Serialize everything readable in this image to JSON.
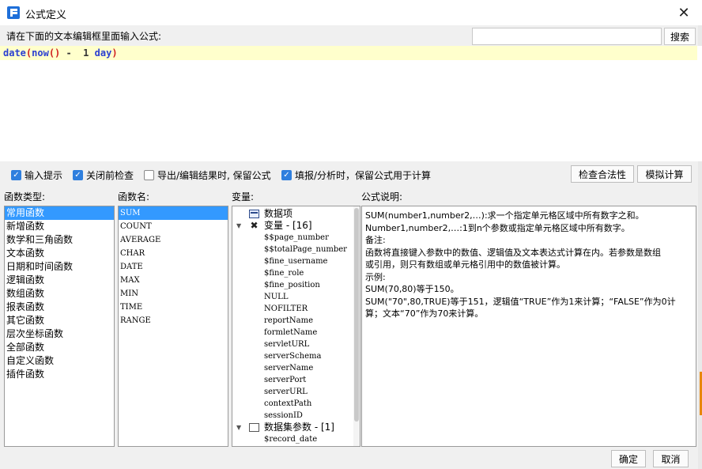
{
  "window": {
    "title": "公式定义",
    "close_label": "✕"
  },
  "prompt": {
    "label": "请在下面的文本编辑框里面输入公式:",
    "search_placeholder": "",
    "search_button": "搜索"
  },
  "editor": {
    "tokens": [
      "date",
      "(",
      "now",
      "()",
      " -  1 ",
      "day",
      ")"
    ]
  },
  "options": [
    {
      "label": "输入提示",
      "checked": true
    },
    {
      "label": "关闭前检查",
      "checked": true
    },
    {
      "label": "导出/编辑结果时, 保留公式",
      "checked": false
    },
    {
      "label": "填报/分析时，保留公式用于计算",
      "checked": true
    }
  ],
  "buttons": {
    "check": "检查合法性",
    "simulate": "模拟计算",
    "ok": "确定",
    "cancel": "取消"
  },
  "headers": {
    "func_type": "函数类型:",
    "func_name": "函数名:",
    "variables": "变量:",
    "description": "公式说明:"
  },
  "func_types": [
    "常用函数",
    "新增函数",
    "数学和三角函数",
    "文本函数",
    "日期和时间函数",
    "逻辑函数",
    "数组函数",
    "报表函数",
    "其它函数",
    "层次坐标函数",
    "全部函数",
    "自定义函数",
    "插件函数"
  ],
  "func_names": [
    "SUM",
    "COUNT",
    "AVERAGE",
    "CHAR",
    "DATE",
    "MAX",
    "MIN",
    "TIME",
    "RANGE"
  ],
  "variables": {
    "data_item": "数据项",
    "var_group": "变量 - [16]",
    "var_items": [
      "$$page_number",
      "$$totalPage_number",
      "$fine_username",
      "$fine_role",
      "$fine_position",
      "NULL",
      "NOFILTER",
      "reportName",
      "formletName",
      "servletURL",
      "serverSchema",
      "serverName",
      "serverPort",
      "serverURL",
      "contextPath",
      "sessionID"
    ],
    "ds_group": "数据集参数 - [1]",
    "ds_items": [
      "$record_date"
    ]
  },
  "description": [
    "SUM(number1,number2,…):求一个指定单元格区域中所有数字之和。",
    "Number1,number2,…:1到n个参数或指定单元格区域中所有数字。",
    "备注:",
    "函数将直接键入参数中的数值、逻辑值及文本表达式计算在内。若参数是数组",
    "或引用，则只有数组或单元格引用中的数值被计算。",
    "示例:",
    "SUM(70,80)等于150。",
    "SUM(\"70\",80,TRUE)等于151，逻辑值“TRUE”作为1来计算；“FALSE”作为0计",
    "算；文本“70”作为70来计算。"
  ],
  "colors": {
    "selection": "#3399ff",
    "editor_line": "#ffffcc",
    "checkbox": "#2f7fde",
    "function_token": "#2b3fd1",
    "paren_token": "#d02020"
  }
}
